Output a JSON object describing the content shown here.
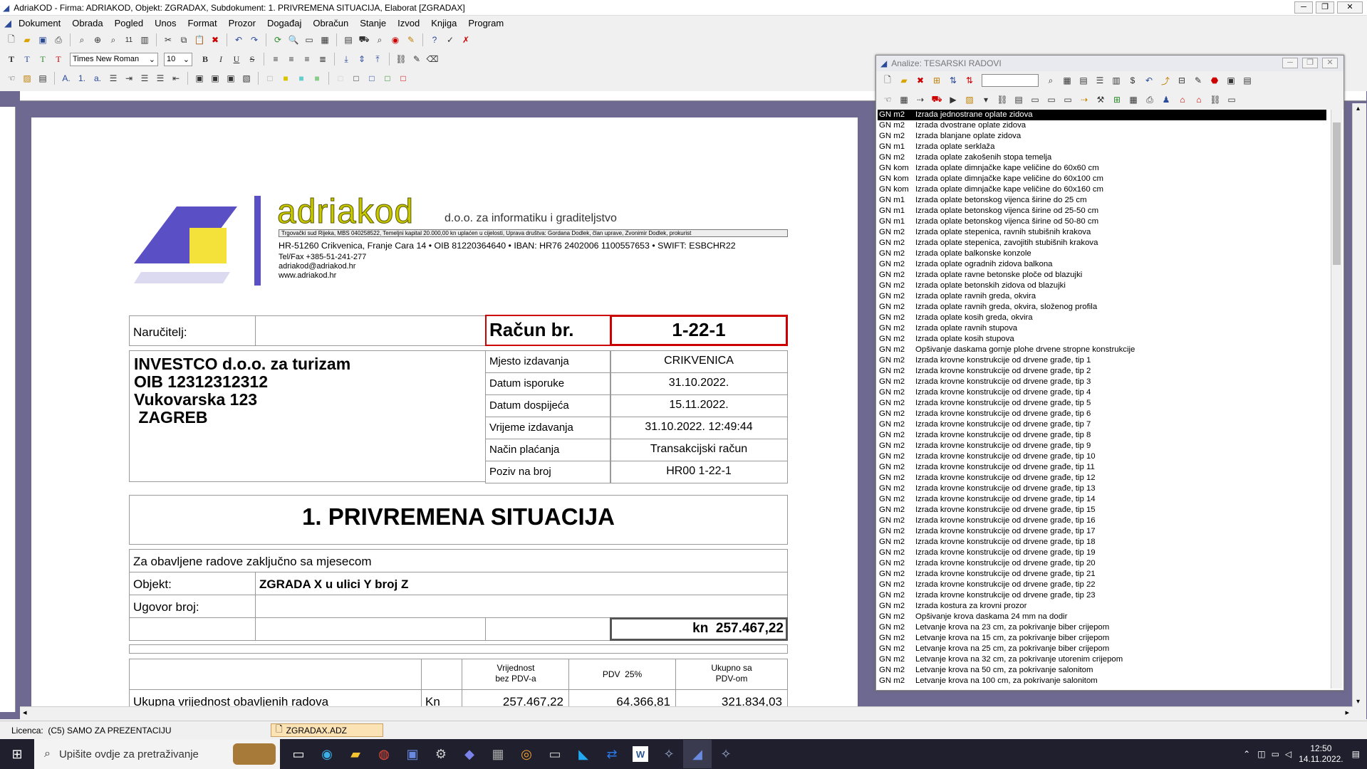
{
  "window": {
    "title": "AdriaKOD - Firma: ADRIAKOD,  Objekt: ZGRADAX,  Subdokument: 1. PRIVREMENA SITUACIJA,  Elaborat [ZGRADAX]"
  },
  "menu": [
    "Dokument",
    "Obrada",
    "Pogled",
    "Unos",
    "Format",
    "Prozor",
    "Događaj",
    "Obračun",
    "Stanje",
    "Izvod",
    "Knjiga",
    "Program"
  ],
  "toolbar2": {
    "font": "Times New Roman",
    "size": "10"
  },
  "doc": {
    "logo_brand": "adriakod",
    "logo_tag": "d.o.o. za informatiku i graditeljstvo",
    "legal": "Trgovački sud Rijeka,  MBS 040258522,  Temeljni kapital 20.000,00 kn uplaćen u cijelosti,  Uprava društva: Gordana Dodlek, član uprave, Zvonimir Dodlek, prokurist",
    "address": "HR-51260 Crikvenica, Franje Cara 14   •   OIB 81220364640   •   IBAN: HR76 2402006 1100557653   •   SWIFT: ESBCHR22",
    "tel": "Tel/Fax +385-51-241-277",
    "email": "adriakod@adriakod.hr",
    "web": "www.adriakod.hr",
    "narucitelj_label": "Naručitelj:",
    "racun_label": "Račun br.",
    "racun_no": "1-22-1",
    "client_name": "INVESTCO d.o.o. za turizam",
    "client_oib": "OIB 12312312312",
    "client_street": "Vukovarska 123",
    "client_city": " ZAGREB",
    "meta": [
      {
        "label": "Mjesto izdavanja",
        "value": "CRIKVENICA"
      },
      {
        "label": "Datum isporuke",
        "value": "31.10.2022."
      },
      {
        "label": "Datum dospijeća",
        "value": "15.11.2022."
      },
      {
        "label": "Vrijeme izdavanja",
        "value": "31.10.2022. 12:49:44"
      },
      {
        "label": "Način plaćanja",
        "value": "Transakcijski račun"
      },
      {
        "label": "Poziv na broj",
        "value": "HR00 1-22-1"
      }
    ],
    "heading": "1. PRIVREMENA SITUACIJA",
    "za_text": "Za obavljene radove zaključno sa mjesecom",
    "objekt_label": "Objekt:",
    "objekt_value": "ZGRADA X u ulici Y broj Z",
    "ugovor_label": "Ugovor broj:",
    "total_kn": "kn  257.467,22",
    "col1": "Vrijednost bez PDV-a",
    "col2": "PDV  25%",
    "col3": "Ukupno sa PDV-om",
    "row_label": "Ukupna vrijednost obavljenih radova",
    "row_unit": "Kn",
    "row_v1": "257.467,22",
    "row_v2": "64.366,81",
    "row_v3": "321.834,03"
  },
  "analyze": {
    "title": "Analize: TESARSKI RADOVI",
    "items": [
      {
        "u": "GN m2",
        "t": "Izrada jednostrane oplate zidova"
      },
      {
        "u": "GN m2",
        "t": "Izrada dvostrane oplate zidova"
      },
      {
        "u": "GN m2",
        "t": "Izrada blanjane oplate zidova"
      },
      {
        "u": "GN m1",
        "t": "Izrada oplate serklaža"
      },
      {
        "u": "GN m2",
        "t": "Izrada oplate zakošenih stopa temelja"
      },
      {
        "u": "GN kom",
        "t": "Izrada oplate dimnjačke kape veličine do 60x60 cm"
      },
      {
        "u": "GN kom",
        "t": "Izrada oplate dimnjačke kape veličine do 60x100 cm"
      },
      {
        "u": "GN kom",
        "t": "Izrada oplate dimnjačke kape veličine do 60x160 cm"
      },
      {
        "u": "GN m1",
        "t": "Izrada oplate betonskog vijenca širine do 25 cm"
      },
      {
        "u": "GN m1",
        "t": "Izrada oplate betonskog vijenca širine od 25-50 cm"
      },
      {
        "u": "GN m1",
        "t": "Izrada oplate betonskog vijenca širine od 50-80 cm"
      },
      {
        "u": "GN m2",
        "t": "Izrada oplate stepenica, ravnih stubišnih krakova"
      },
      {
        "u": "GN m2",
        "t": "Izrada oplate stepenica, zavojitih stubišnih krakova"
      },
      {
        "u": "GN m2",
        "t": "Izrada oplate balkonske konzole"
      },
      {
        "u": "GN m2",
        "t": "Izrada oplate ogradnih zidova balkona"
      },
      {
        "u": "GN m2",
        "t": "Izrada oplate ravne betonske ploče od blazujki"
      },
      {
        "u": "GN m2",
        "t": "Izrada oplate betonskih zidova od blazujki"
      },
      {
        "u": "GN m2",
        "t": "Izrada oplate ravnih greda, okvira"
      },
      {
        "u": "GN m2",
        "t": "Izrada oplate ravnih greda, okvira, složenog profila"
      },
      {
        "u": "GN m2",
        "t": "Izrada oplate kosih greda, okvira"
      },
      {
        "u": "GN m2",
        "t": "Izrada oplate ravnih stupova"
      },
      {
        "u": "GN m2",
        "t": "Izrada oplate kosih stupova"
      },
      {
        "u": "GN m2",
        "t": "Opšivanje daskama gornje plohe drvene stropne konstrukcije"
      },
      {
        "u": "GN m2",
        "t": "Izrada krovne konstrukcije od drvene građe, tip 1"
      },
      {
        "u": "GN m2",
        "t": "Izrada krovne konstrukcije od drvene građe, tip 2"
      },
      {
        "u": "GN m2",
        "t": "Izrada krovne konstrukcije od drvene građe, tip 3"
      },
      {
        "u": "GN m2",
        "t": "Izrada krovne konstrukcije od drvene građe, tip 4"
      },
      {
        "u": "GN m2",
        "t": "Izrada krovne konstrukcije od drvene građe, tip 5"
      },
      {
        "u": "GN m2",
        "t": "Izrada krovne konstrukcije od drvene građe, tip 6"
      },
      {
        "u": "GN m2",
        "t": "Izrada krovne konstrukcije od drvene građe, tip 7"
      },
      {
        "u": "GN m2",
        "t": "Izrada krovne konstrukcije od drvene građe, tip 8"
      },
      {
        "u": "GN m2",
        "t": "Izrada krovne konstrukcije od drvene građe, tip 9"
      },
      {
        "u": "GN m2",
        "t": "Izrada krovne konstrukcije od drvene građe, tip 10"
      },
      {
        "u": "GN m2",
        "t": "Izrada krovne konstrukcije od drvene građe, tip 11"
      },
      {
        "u": "GN m2",
        "t": "Izrada krovne konstrukcije od drvene građe, tip 12"
      },
      {
        "u": "GN m2",
        "t": "Izrada krovne konstrukcije od drvene građe, tip 13"
      },
      {
        "u": "GN m2",
        "t": "Izrada krovne konstrukcije od drvene građe, tip 14"
      },
      {
        "u": "GN m2",
        "t": "Izrada krovne konstrukcije od drvene građe, tip 15"
      },
      {
        "u": "GN m2",
        "t": "Izrada krovne konstrukcije od drvene građe, tip 16"
      },
      {
        "u": "GN m2",
        "t": "Izrada krovne konstrukcije od drvene građe, tip 17"
      },
      {
        "u": "GN m2",
        "t": "Izrada krovne konstrukcije od drvene građe, tip 18"
      },
      {
        "u": "GN m2",
        "t": "Izrada krovne konstrukcije od drvene građe, tip 19"
      },
      {
        "u": "GN m2",
        "t": "Izrada krovne konstrukcije od drvene građe, tip 20"
      },
      {
        "u": "GN m2",
        "t": "Izrada krovne konstrukcije od drvene građe, tip 21"
      },
      {
        "u": "GN m2",
        "t": "Izrada krovne konstrukcije od drvene građe, tip 22"
      },
      {
        "u": "GN m2",
        "t": "Izrada krovne konstrukcije od drvene građe, tip 23"
      },
      {
        "u": "GN m2",
        "t": "Izrada kostura za krovni prozor"
      },
      {
        "u": "GN m2",
        "t": "Opšivanje krova daskama 24 mm na dodir"
      },
      {
        "u": "GN m2",
        "t": "Letvanje krova na 23 cm, za pokrivanje biber crijepom"
      },
      {
        "u": "GN m2",
        "t": "Letvanje krova na 15 cm, za pokrivanje biber crijepom"
      },
      {
        "u": "GN m2",
        "t": "Letvanje krova na 25 cm, za pokrivanje biber crijepom"
      },
      {
        "u": "GN m2",
        "t": "Letvanje krova na 32 cm, za pokrivanje utorenim crijepom"
      },
      {
        "u": "GN m2",
        "t": "Letvanje krova na 50 cm, za pokrivanje salonitom"
      },
      {
        "u": "GN m2",
        "t": "Letvanje krova na 100 cm, za pokrivanje salonitom"
      }
    ]
  },
  "status": {
    "licence": "Licenca:  (C5) SAMO ZA PREZENTACIJU",
    "tab": "ZGRADAX.ADZ"
  },
  "taskbar": {
    "search": "Upišite ovdje za pretraživanje",
    "time": "12:50",
    "date": "14.11.2022."
  }
}
